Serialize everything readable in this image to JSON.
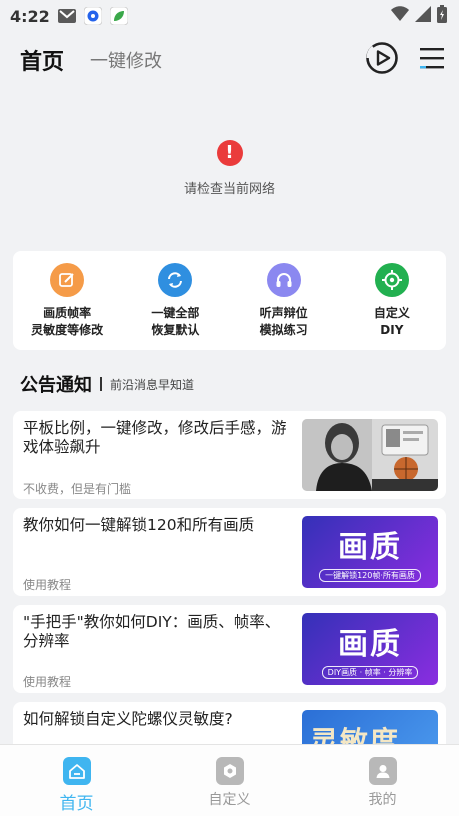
{
  "statusbar": {
    "time": "4:22"
  },
  "header": {
    "tab_home": "首页",
    "tab_modify": "一键修改"
  },
  "network_error": {
    "icon_glyph": "!",
    "message": "请检查当前网络"
  },
  "features": [
    {
      "label": "画质帧率\n灵敏度等修改",
      "color": "#f59b48",
      "icon": "edit-icon"
    },
    {
      "label": "一键全部\n恢复默认",
      "color": "#2f8fe0",
      "icon": "refresh-icon"
    },
    {
      "label": "听声辩位\n模拟练习",
      "color": "#8b88f0",
      "icon": "headset-icon"
    },
    {
      "label": "自定义\nDIY",
      "color": "#22b050",
      "icon": "crosshair-icon"
    }
  ],
  "notice": {
    "title": "公告通知",
    "subtitle": "前沿消息早知道"
  },
  "articles": [
    {
      "title": "平板比例，一键修改，修改后手感，游戏体验飙升",
      "tag": "不收费，但是有门槛"
    },
    {
      "title": "教你如何一键解锁120和所有画质",
      "tag": "使用教程",
      "thumb_big": "画质",
      "thumb_small": "一键解锁120帧·所有画质"
    },
    {
      "title": "\"手把手\"教你如何DIY：画质、帧率、分辨率",
      "tag": "使用教程",
      "thumb_big": "画质",
      "thumb_small": "DIY画质 · 帧率 · 分辨率"
    },
    {
      "title": "如何解锁自定义陀螺仪灵敏度?",
      "thumb_big": "灵敏度"
    }
  ],
  "bottom_nav": [
    {
      "label": "首页"
    },
    {
      "label": "自定义"
    },
    {
      "label": "我的"
    }
  ],
  "colors": {
    "accent": "#3fb5f0",
    "error": "#ea3b3b"
  }
}
